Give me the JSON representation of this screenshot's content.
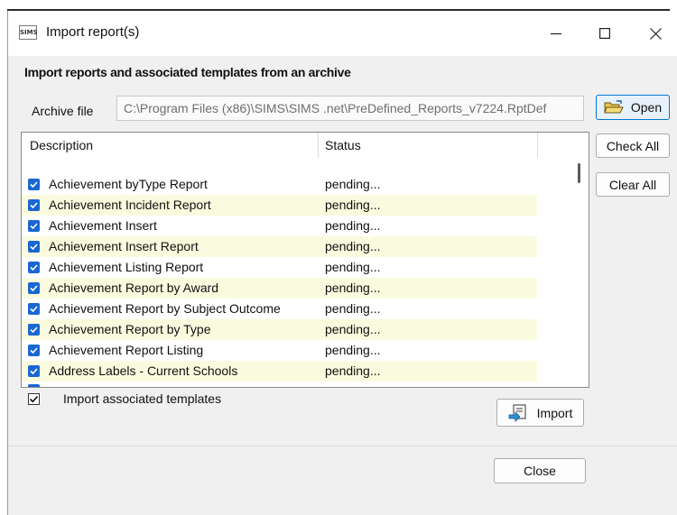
{
  "window": {
    "title": "Import report(s)",
    "app_icon_text": "SIMS"
  },
  "heading": "Import reports and associated templates from an archive",
  "archive": {
    "label": "Archive file",
    "value": "C:\\Program Files (x86)\\SIMS\\SIMS .net\\PreDefined_Reports_v7224.RptDef"
  },
  "buttons": {
    "open": "Open",
    "check_all": "Check All",
    "clear_all": "Clear All",
    "import": "Import",
    "close": "Close"
  },
  "list": {
    "columns": [
      "Description",
      "Status"
    ],
    "rows": [
      {
        "description": "Achievement byType Report",
        "status": "pending...",
        "checked": true
      },
      {
        "description": "Achievement Incident Report",
        "status": "pending...",
        "checked": true
      },
      {
        "description": "Achievement Insert",
        "status": "pending...",
        "checked": true
      },
      {
        "description": "Achievement Insert Report",
        "status": "pending...",
        "checked": true
      },
      {
        "description": "Achievement Listing Report",
        "status": "pending...",
        "checked": true
      },
      {
        "description": "Achievement Report by Award",
        "status": "pending...",
        "checked": true
      },
      {
        "description": "Achievement Report by Subject Outcome",
        "status": "pending...",
        "checked": true
      },
      {
        "description": "Achievement Report by Type",
        "status": "pending...",
        "checked": true
      },
      {
        "description": "Achievement Report Listing",
        "status": "pending...",
        "checked": true
      },
      {
        "description": "Address Labels - Current Schools",
        "status": "pending...",
        "checked": true
      }
    ]
  },
  "templates_option": {
    "label": "Import associated templates",
    "checked": true
  },
  "colors": {
    "checkbox_blue": "#1a67d2",
    "alt_row": "#fafade",
    "accent_border": "#0078d4"
  },
  "icons": [
    "minimize-icon",
    "maximize-icon",
    "close-icon",
    "folder-open-icon",
    "import-icon",
    "checkmark-icon"
  ]
}
